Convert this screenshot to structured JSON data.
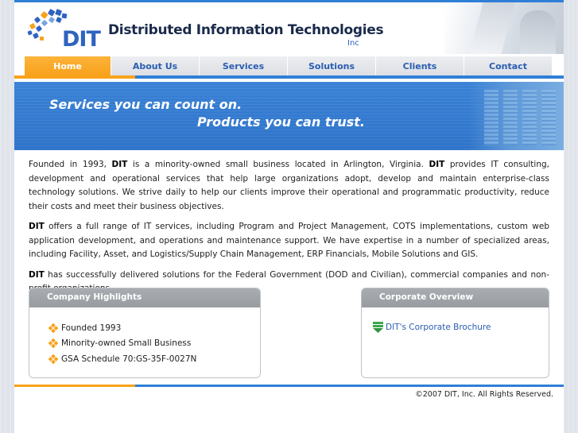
{
  "header": {
    "logo_text": "DIT",
    "company_name": "Distributed Information Technologies",
    "company_suffix": "Inc"
  },
  "nav": {
    "items": [
      {
        "label": "Home",
        "active": true
      },
      {
        "label": "About Us",
        "active": false
      },
      {
        "label": "Services",
        "active": false
      },
      {
        "label": "Solutions",
        "active": false
      },
      {
        "label": "Clients",
        "active": false
      },
      {
        "label": "Contact",
        "active": false
      }
    ]
  },
  "banner": {
    "line1": "Services you can count on.",
    "line2": "Products you can trust."
  },
  "content": {
    "p1_pre": "Founded in 1993, ",
    "p1_b1": "DIT",
    "p1_mid": " is a minority-owned small business located in Arlington, Virginia.  ",
    "p1_b2": "DIT",
    "p1_post": " provides IT consulting, development and operational services that help large organizations adopt, develop and maintain enterprise-class technology solutions.  We strive daily to help our clients improve their operational and programmatic productivity, reduce their costs and meet their business objectives.",
    "p2_b": "DIT",
    "p2_post": " offers a full range of IT services, including Program and Project Management, COTS implementations, custom web application development, and operations and maintenance support.  We have expertise in a number of specialized areas, including Facility, Asset, and Logistics/Supply Chain Management, ERP Financials, Mobile Solutions and GIS.",
    "p3_b": "DIT",
    "p3_post": " has successfully delivered solutions for the Federal Government (DOD and Civilian), commercial companies and non-profit organizations."
  },
  "highlights": {
    "title": "Company Highlights",
    "items": [
      "Founded 1993",
      "Minority-owned Small Business",
      "GSA Schedule 70:GS-35F-0027N"
    ]
  },
  "overview": {
    "title": "Corporate Overview",
    "link": "DIT's Corporate Brochure"
  },
  "footer": {
    "copyright": "©2007 DIT, Inc. All Rights Reserved."
  },
  "colors": {
    "accent_orange": "#f7a21b",
    "accent_blue": "#2f7fd6",
    "nav_text": "#2a5db0"
  }
}
